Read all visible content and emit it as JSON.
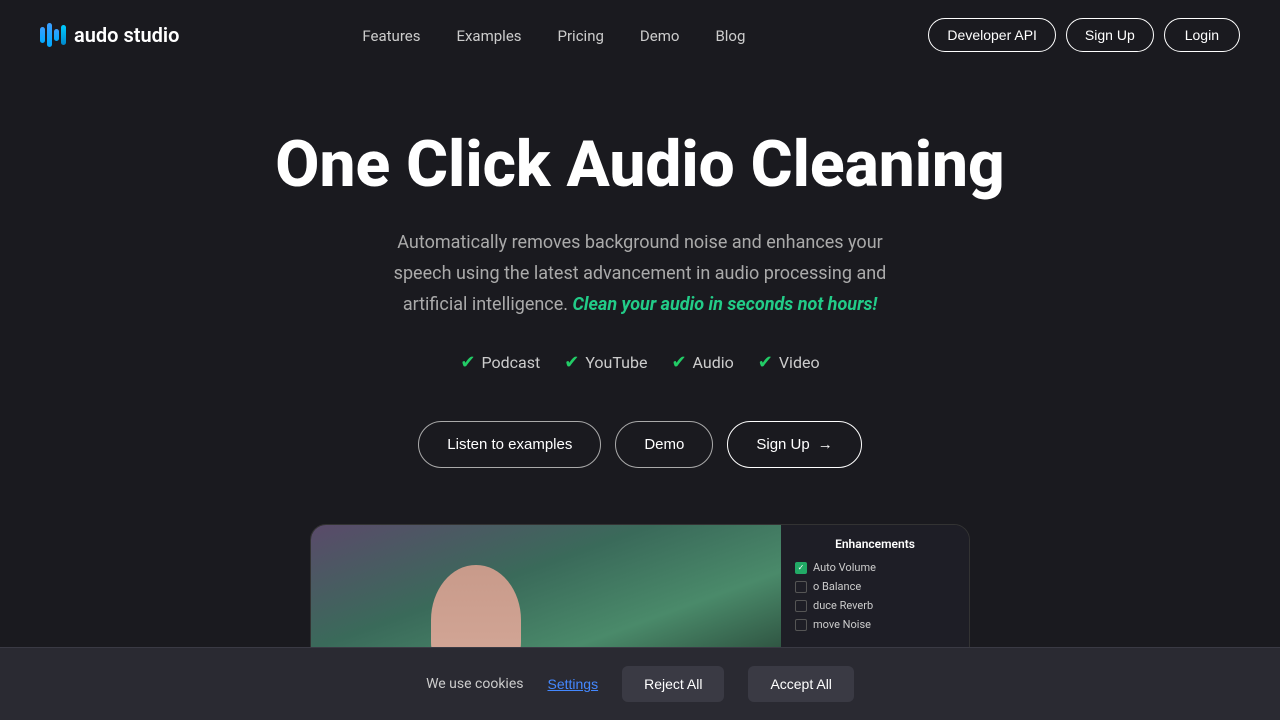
{
  "brand": {
    "name": "audo studio",
    "logo_alt": "Audo Studio Logo"
  },
  "nav": {
    "links": [
      {
        "label": "Features",
        "href": "#"
      },
      {
        "label": "Examples",
        "href": "#"
      },
      {
        "label": "Pricing",
        "href": "#"
      },
      {
        "label": "Demo",
        "href": "#"
      },
      {
        "label": "Blog",
        "href": "#"
      }
    ],
    "developer_api": "Developer API",
    "signup": "Sign Up",
    "login": "Login"
  },
  "hero": {
    "title": "One Click Audio Cleaning",
    "subtitle": "Automatically removes background noise and enhances your speech using the latest advancement in audio processing and artificial intelligence.",
    "highlight": "Clean your audio in seconds not hours!",
    "badges": [
      {
        "label": "Podcast"
      },
      {
        "label": "YouTube"
      },
      {
        "label": "Audio"
      },
      {
        "label": "Video"
      }
    ],
    "btn_listen": "Listen to examples",
    "btn_demo": "Demo",
    "btn_signup": "Sign Up",
    "arrow": "→"
  },
  "preview": {
    "panel_title": "Enhancements",
    "items": [
      {
        "label": "Auto Volume",
        "checked": true
      },
      {
        "label": "o Balance",
        "checked": false
      },
      {
        "label": "duce Reverb",
        "checked": false
      },
      {
        "label": "move Noise",
        "checked": false
      }
    ]
  },
  "cookie": {
    "message": "We use cookies",
    "settings": "Settings",
    "reject": "Reject All",
    "accept": "Accept All"
  }
}
